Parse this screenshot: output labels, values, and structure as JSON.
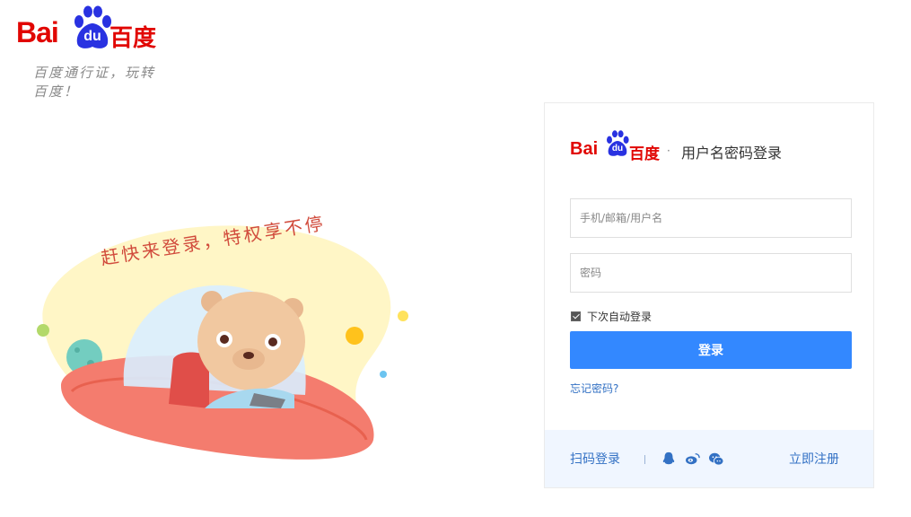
{
  "brand": {
    "logo_latin": "Bai",
    "logo_du": "du",
    "logo_cn": "百度",
    "slogan": "百度通行证，玩转百度！"
  },
  "illustration": {
    "caption": "赶快来登录，特权享不停"
  },
  "login_card": {
    "logo_latin": "Bai",
    "logo_du": "du",
    "logo_cn": "百度",
    "separator": "·",
    "title": "用户名密码登录",
    "username_placeholder": "手机/邮箱/用户名",
    "password_placeholder": "密码",
    "remember_label": "下次自动登录",
    "remember_checked": true,
    "login_button": "登录",
    "forgot_link": "忘记密码?",
    "footer": {
      "qr_login": "扫码登录",
      "register": "立即注册",
      "social_icons": [
        "qq-icon",
        "weibo-icon",
        "wechat-icon"
      ]
    }
  },
  "colors": {
    "brand_red": "#e10602",
    "brand_blue": "#2932e1",
    "primary_button": "#3388ff",
    "link_blue": "#3371c4",
    "footer_bg": "#f0f6ff"
  }
}
